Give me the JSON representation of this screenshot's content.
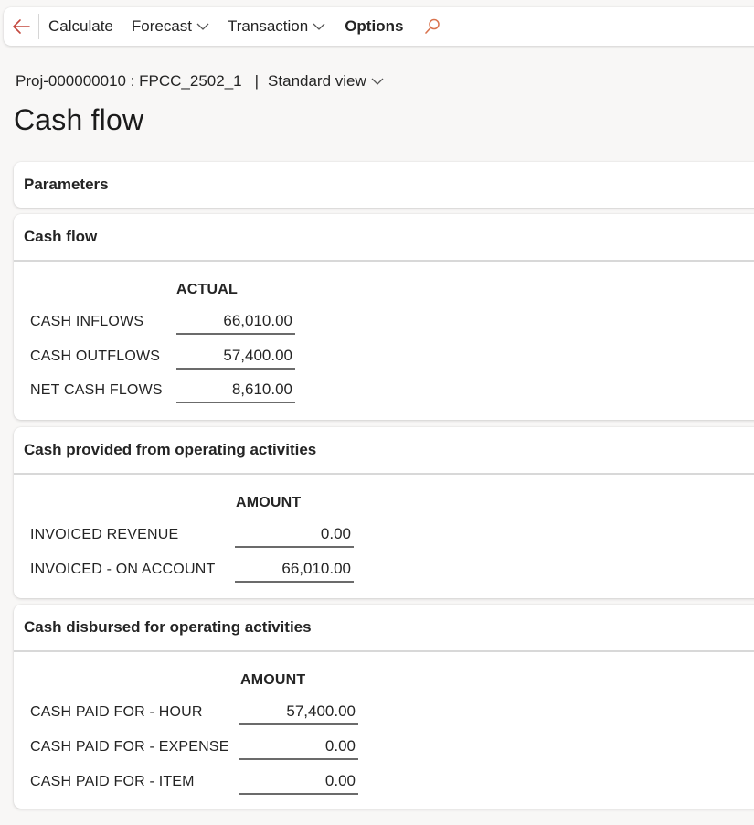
{
  "toolbar": {
    "back_icon": "arrow-left-icon",
    "buttons": [
      {
        "label": "Calculate",
        "has_dropdown": false
      },
      {
        "label": "Forecast",
        "has_dropdown": true
      },
      {
        "label": "Transaction",
        "has_dropdown": true
      },
      {
        "label": "Options",
        "has_dropdown": false
      }
    ],
    "search_icon": "search-icon",
    "accent_color": "#c4493f"
  },
  "header": {
    "breadcrumb": "Proj-000000010 : FPCC_2502_1",
    "separator": "|",
    "view_selector": "Standard view",
    "title": "Cash flow"
  },
  "sections": {
    "parameters": {
      "title": "Parameters",
      "expanded": false
    },
    "cash_flow": {
      "title": "Cash flow",
      "expanded": true,
      "column_header": "ACTUAL",
      "rows": [
        {
          "label": "CASH INFLOWS",
          "value": "66,010.00"
        },
        {
          "label": "CASH OUTFLOWS",
          "value": "57,400.00"
        },
        {
          "label": "NET CASH FLOWS",
          "value": "8,610.00"
        }
      ]
    },
    "provided": {
      "title": "Cash provided from operating activities",
      "expanded": true,
      "column_header": "AMOUNT",
      "rows": [
        {
          "label": "INVOICED REVENUE",
          "value": "0.00"
        },
        {
          "label": "INVOICED - ON ACCOUNT",
          "value": "66,010.00"
        }
      ]
    },
    "disbursed": {
      "title": "Cash disbursed for operating activities",
      "expanded": true,
      "column_header": "AMOUNT",
      "rows": [
        {
          "label": "CASH PAID FOR - HOUR",
          "value": "57,400.00"
        },
        {
          "label": "CASH PAID FOR - EXPENSE",
          "value": "0.00"
        },
        {
          "label": "CASH PAID FOR - ITEM",
          "value": "0.00"
        }
      ]
    }
  }
}
